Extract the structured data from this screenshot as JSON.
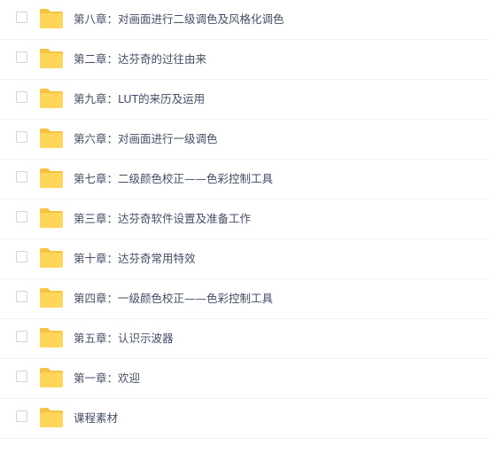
{
  "file_list": {
    "items": [
      {
        "name": "第八章：对画面进行二级调色及风格化调色",
        "type": "folder",
        "checked": false
      },
      {
        "name": "第二章：达芬奇的过往由来",
        "type": "folder",
        "checked": false
      },
      {
        "name": "第九章：LUT的来历及运用",
        "type": "folder",
        "checked": false
      },
      {
        "name": "第六章：对画面进行一级调色",
        "type": "folder",
        "checked": false
      },
      {
        "name": "第七章：二级颜色校正——色彩控制工具",
        "type": "folder",
        "checked": false
      },
      {
        "name": "第三章：达芬奇软件设置及准备工作",
        "type": "folder",
        "checked": false
      },
      {
        "name": "第十章：达芬奇常用特效",
        "type": "folder",
        "checked": false
      },
      {
        "name": "第四章：一级颜色校正——色彩控制工具",
        "type": "folder",
        "checked": false
      },
      {
        "name": "第五章：认识示波器",
        "type": "folder",
        "checked": false
      },
      {
        "name": "第一章：欢迎",
        "type": "folder",
        "checked": false
      },
      {
        "name": "课程素材",
        "type": "folder",
        "checked": false
      }
    ]
  },
  "icons": {
    "row_icon": "folder-icon"
  },
  "colors": {
    "folder_body": "#ffd659",
    "folder_tab": "#f5c33f",
    "text": "#424e67",
    "checkbox_border": "#d0d3d9",
    "divider": "#f1f2f4"
  }
}
